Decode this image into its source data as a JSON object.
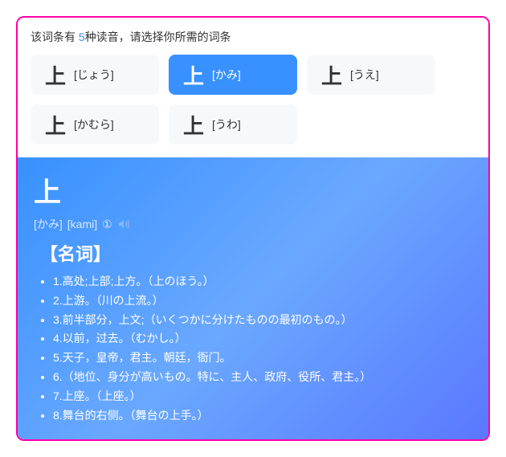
{
  "prompt_prefix": "该词条有 ",
  "prompt_count": "5",
  "prompt_suffix": "种读音，请选择你所需的词条",
  "readings": [
    {
      "kanji": "上",
      "kana": "[じょう]",
      "active": false
    },
    {
      "kanji": "上",
      "kana": "[かみ]",
      "active": true
    },
    {
      "kanji": "上",
      "kana": "[うえ]",
      "active": false
    },
    {
      "kanji": "上",
      "kana": "[かむら]",
      "active": false
    },
    {
      "kanji": "上",
      "kana": "[うわ]",
      "active": false
    }
  ],
  "entry": {
    "headword": "上",
    "phonetic_kana": "[かみ]",
    "phonetic_romaji": "[kami]",
    "accent": "①",
    "pos": "【名词】",
    "definitions": [
      "1.高处;上部;上方。（上のほう。）",
      "2.上游。（川の上流。）",
      "3.前半部分，上文;（いくつかに分けたものの最初のもの。）",
      "4.以前，过去。（むかし。）",
      "5.天子，皇帝，君主。朝廷，衙门。",
      "6.（地位、身分が高いもの。特に、主人、政府、役所、君主。）",
      "7.上座。（上座。）",
      "8.舞台的右侧。（舞台の上手。）"
    ]
  }
}
